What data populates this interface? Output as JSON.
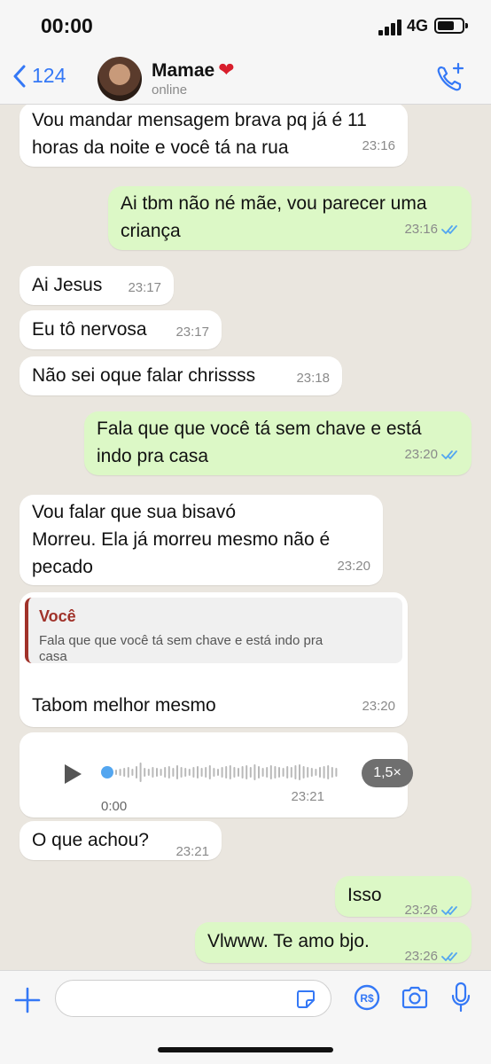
{
  "status_bar": {
    "time": "00:00",
    "network": "4G"
  },
  "header": {
    "back_count": "124",
    "contact_name": "Mamae",
    "heart": "❤",
    "status": "online"
  },
  "messages": [
    {
      "dir": "in",
      "lines": [
        "Vou mandar mensagem brava pq já é 11",
        "horas da noite e você tá na rua"
      ],
      "time": "23:16"
    },
    {
      "dir": "out",
      "lines": [
        "Ai tbm não né mãe, vou parecer  uma",
        "criança"
      ],
      "time": "23:16",
      "read": true
    },
    {
      "dir": "in",
      "lines": [
        "Ai Jesus"
      ],
      "time": "23:17"
    },
    {
      "dir": "in",
      "lines": [
        "Eu tô nervosa"
      ],
      "time": "23:17"
    },
    {
      "dir": "in",
      "lines": [
        "Não sei oque falar chrissss"
      ],
      "time": "23:18"
    },
    {
      "dir": "out",
      "lines": [
        "Fala que que você tá sem chave e está",
        "indo pra casa"
      ],
      "time": "23:20",
      "read": true
    },
    {
      "dir": "in",
      "lines": [
        "Vou falar que sua bisavó",
        "Morreu. Ela já morreu mesmo não é",
        "pecado"
      ],
      "time": "23:20"
    },
    {
      "dir": "in",
      "reply_to": {
        "author": "Você",
        "text": [
          "Fala que que você tá sem chave e está indo pra",
          "casa"
        ]
      },
      "lines": [
        "Tabom melhor mesmo"
      ],
      "time": "23:20"
    },
    {
      "dir": "in",
      "type": "audio",
      "position": "0:00",
      "speed": "1,5×",
      "progress": 0,
      "time": "23:21"
    },
    {
      "dir": "in",
      "lines": [
        "O que achou?"
      ],
      "time": "23:21"
    },
    {
      "dir": "out",
      "lines": [
        "Isso"
      ],
      "time": "23:26",
      "read": true
    },
    {
      "dir": "out",
      "lines": [
        "Vlwww. Te amo bjo."
      ],
      "time": "23:26",
      "read": true
    }
  ],
  "input": {
    "placeholder": ""
  },
  "colors": {
    "incoming": "#ffffff",
    "outgoing": "#dcf8c6",
    "accent": "#3478f6",
    "read_ticks": "#53a6f0",
    "reply_accent": "#a0322a"
  },
  "icons": [
    "chevron-left-icon",
    "call-add-icon",
    "play-icon",
    "plus-icon",
    "sticker-icon",
    "pay-icon",
    "camera-icon",
    "mic-icon",
    "double-check-icon"
  ]
}
